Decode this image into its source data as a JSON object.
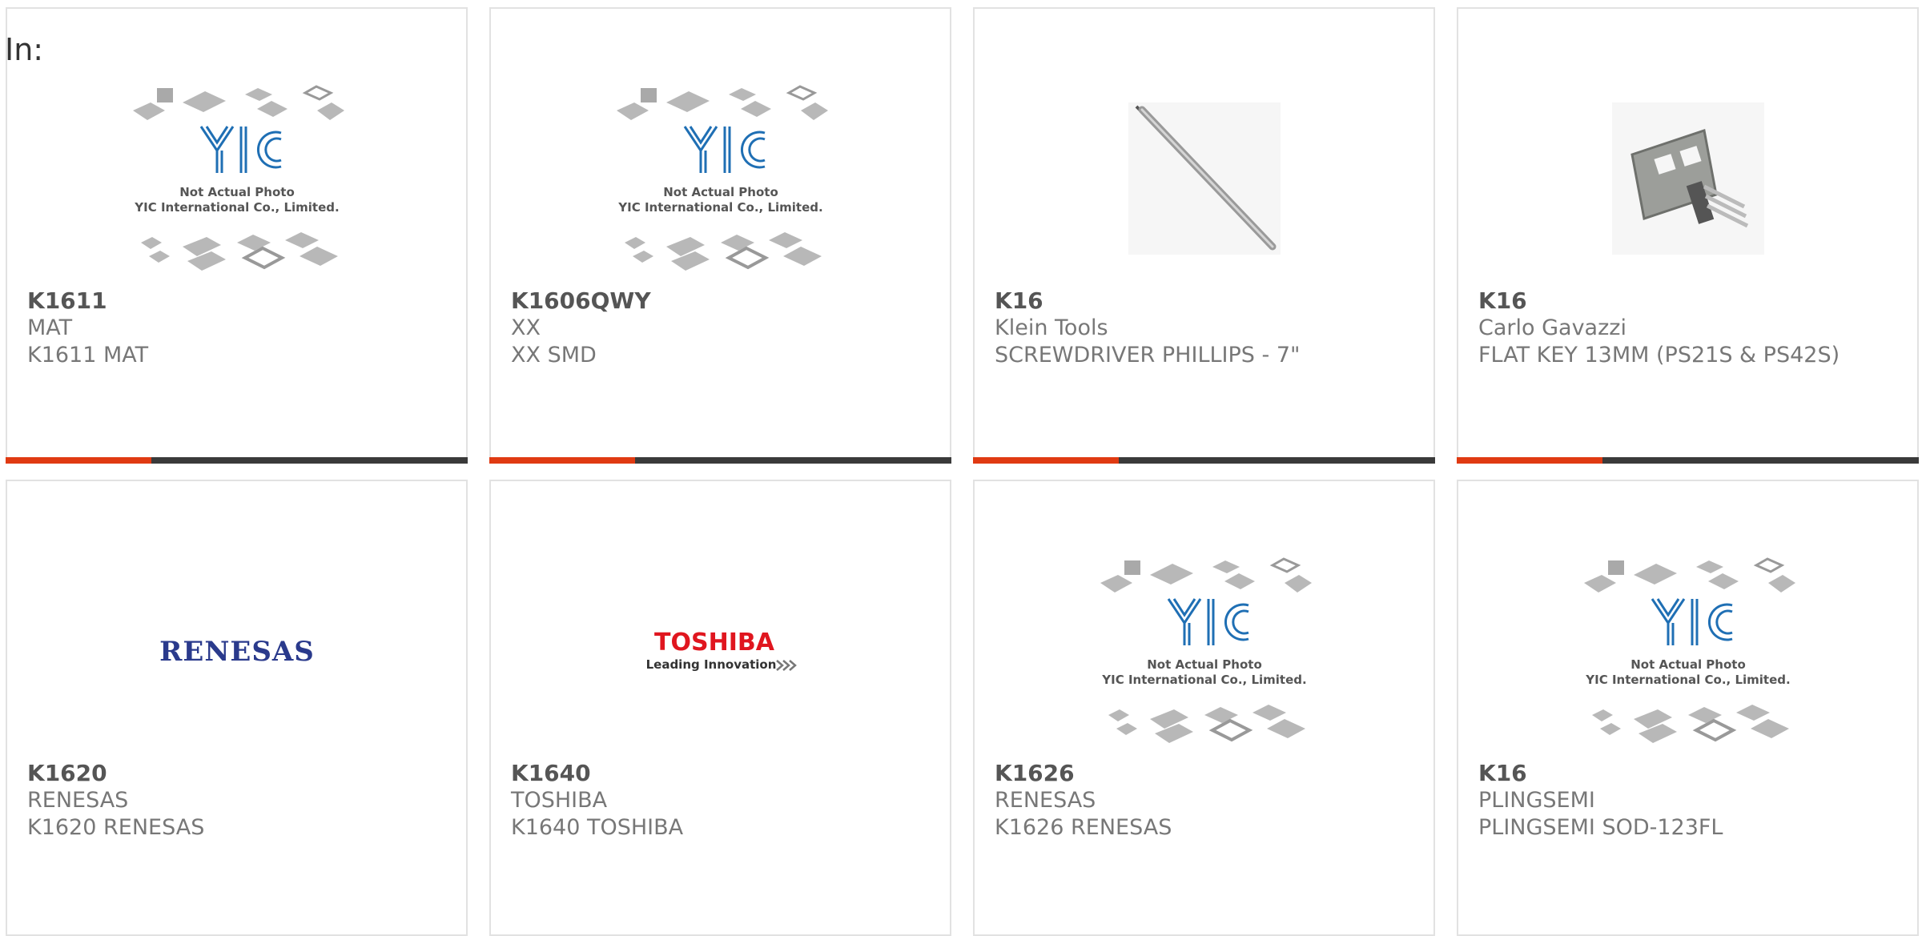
{
  "page_label": "In:",
  "placeholder_note": [
    "Not Actual Photo",
    "YIC International Co., Limited."
  ],
  "brand_logos": {
    "renesas": "RENESAS",
    "toshiba": "TOSHIBA",
    "toshiba_tag": "Leading Innovation"
  },
  "colors": {
    "accent": "#e03a12",
    "bar": "#3a3a3a",
    "border": "#e2e2e2",
    "renesas": "#2a3a8c",
    "toshiba": "#e0161f"
  },
  "products": [
    {
      "part": "K1611",
      "maker": "MAT",
      "desc": "K1611 MAT",
      "image": "placeholder"
    },
    {
      "part": "K1606QWY",
      "maker": "XX",
      "desc": "XX SMD",
      "image": "placeholder"
    },
    {
      "part": "K16",
      "maker": "Klein Tools",
      "desc": "SCREWDRIVER PHILLIPS - 7\"",
      "image": "screwdriver"
    },
    {
      "part": "K16",
      "maker": "Carlo Gavazzi",
      "desc": "FLAT KEY 13MM (PS21S & PS42S)",
      "image": "flat-key"
    },
    {
      "part": "K1620",
      "maker": "RENESAS",
      "desc": "K1620 RENESAS",
      "image": "renesas-logo"
    },
    {
      "part": "K1640",
      "maker": "TOSHIBA",
      "desc": "K1640 TOSHIBA",
      "image": "toshiba-logo"
    },
    {
      "part": "K1626",
      "maker": "RENESAS",
      "desc": "K1626 RENESAS",
      "image": "placeholder"
    },
    {
      "part": "K16",
      "maker": "PLINGSEMI",
      "desc": "PLINGSEMI SOD-123FL",
      "image": "placeholder"
    }
  ]
}
